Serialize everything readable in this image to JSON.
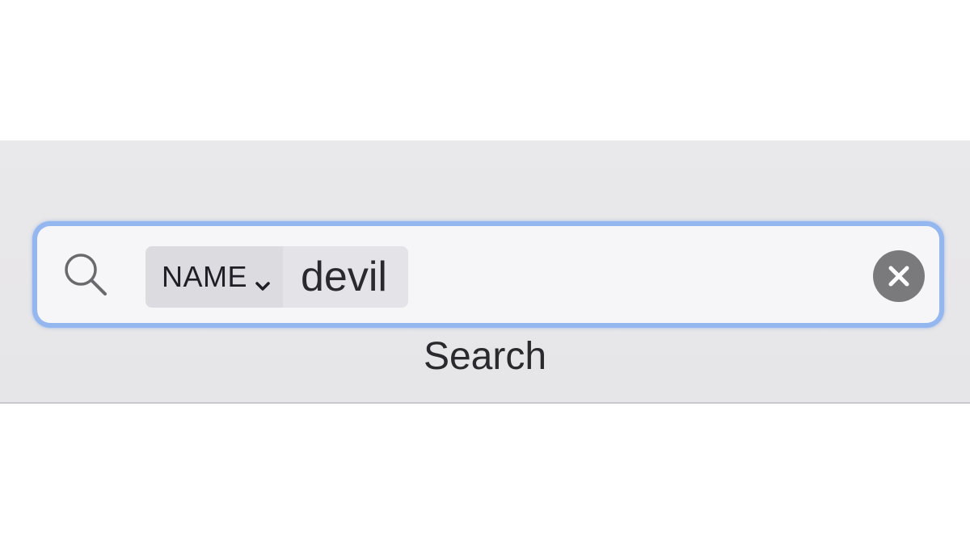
{
  "search": {
    "token_field_label": "NAME",
    "token_value": "devil",
    "caption": "Search"
  },
  "icons": {
    "search": "magnifying-glass",
    "dropdown": "chevron-down",
    "clear": "circle-x"
  },
  "colors": {
    "focus_ring": "#93b7ee",
    "clear_button": "#7a7a7c",
    "toolbar_bg": "#e9e8ea"
  }
}
